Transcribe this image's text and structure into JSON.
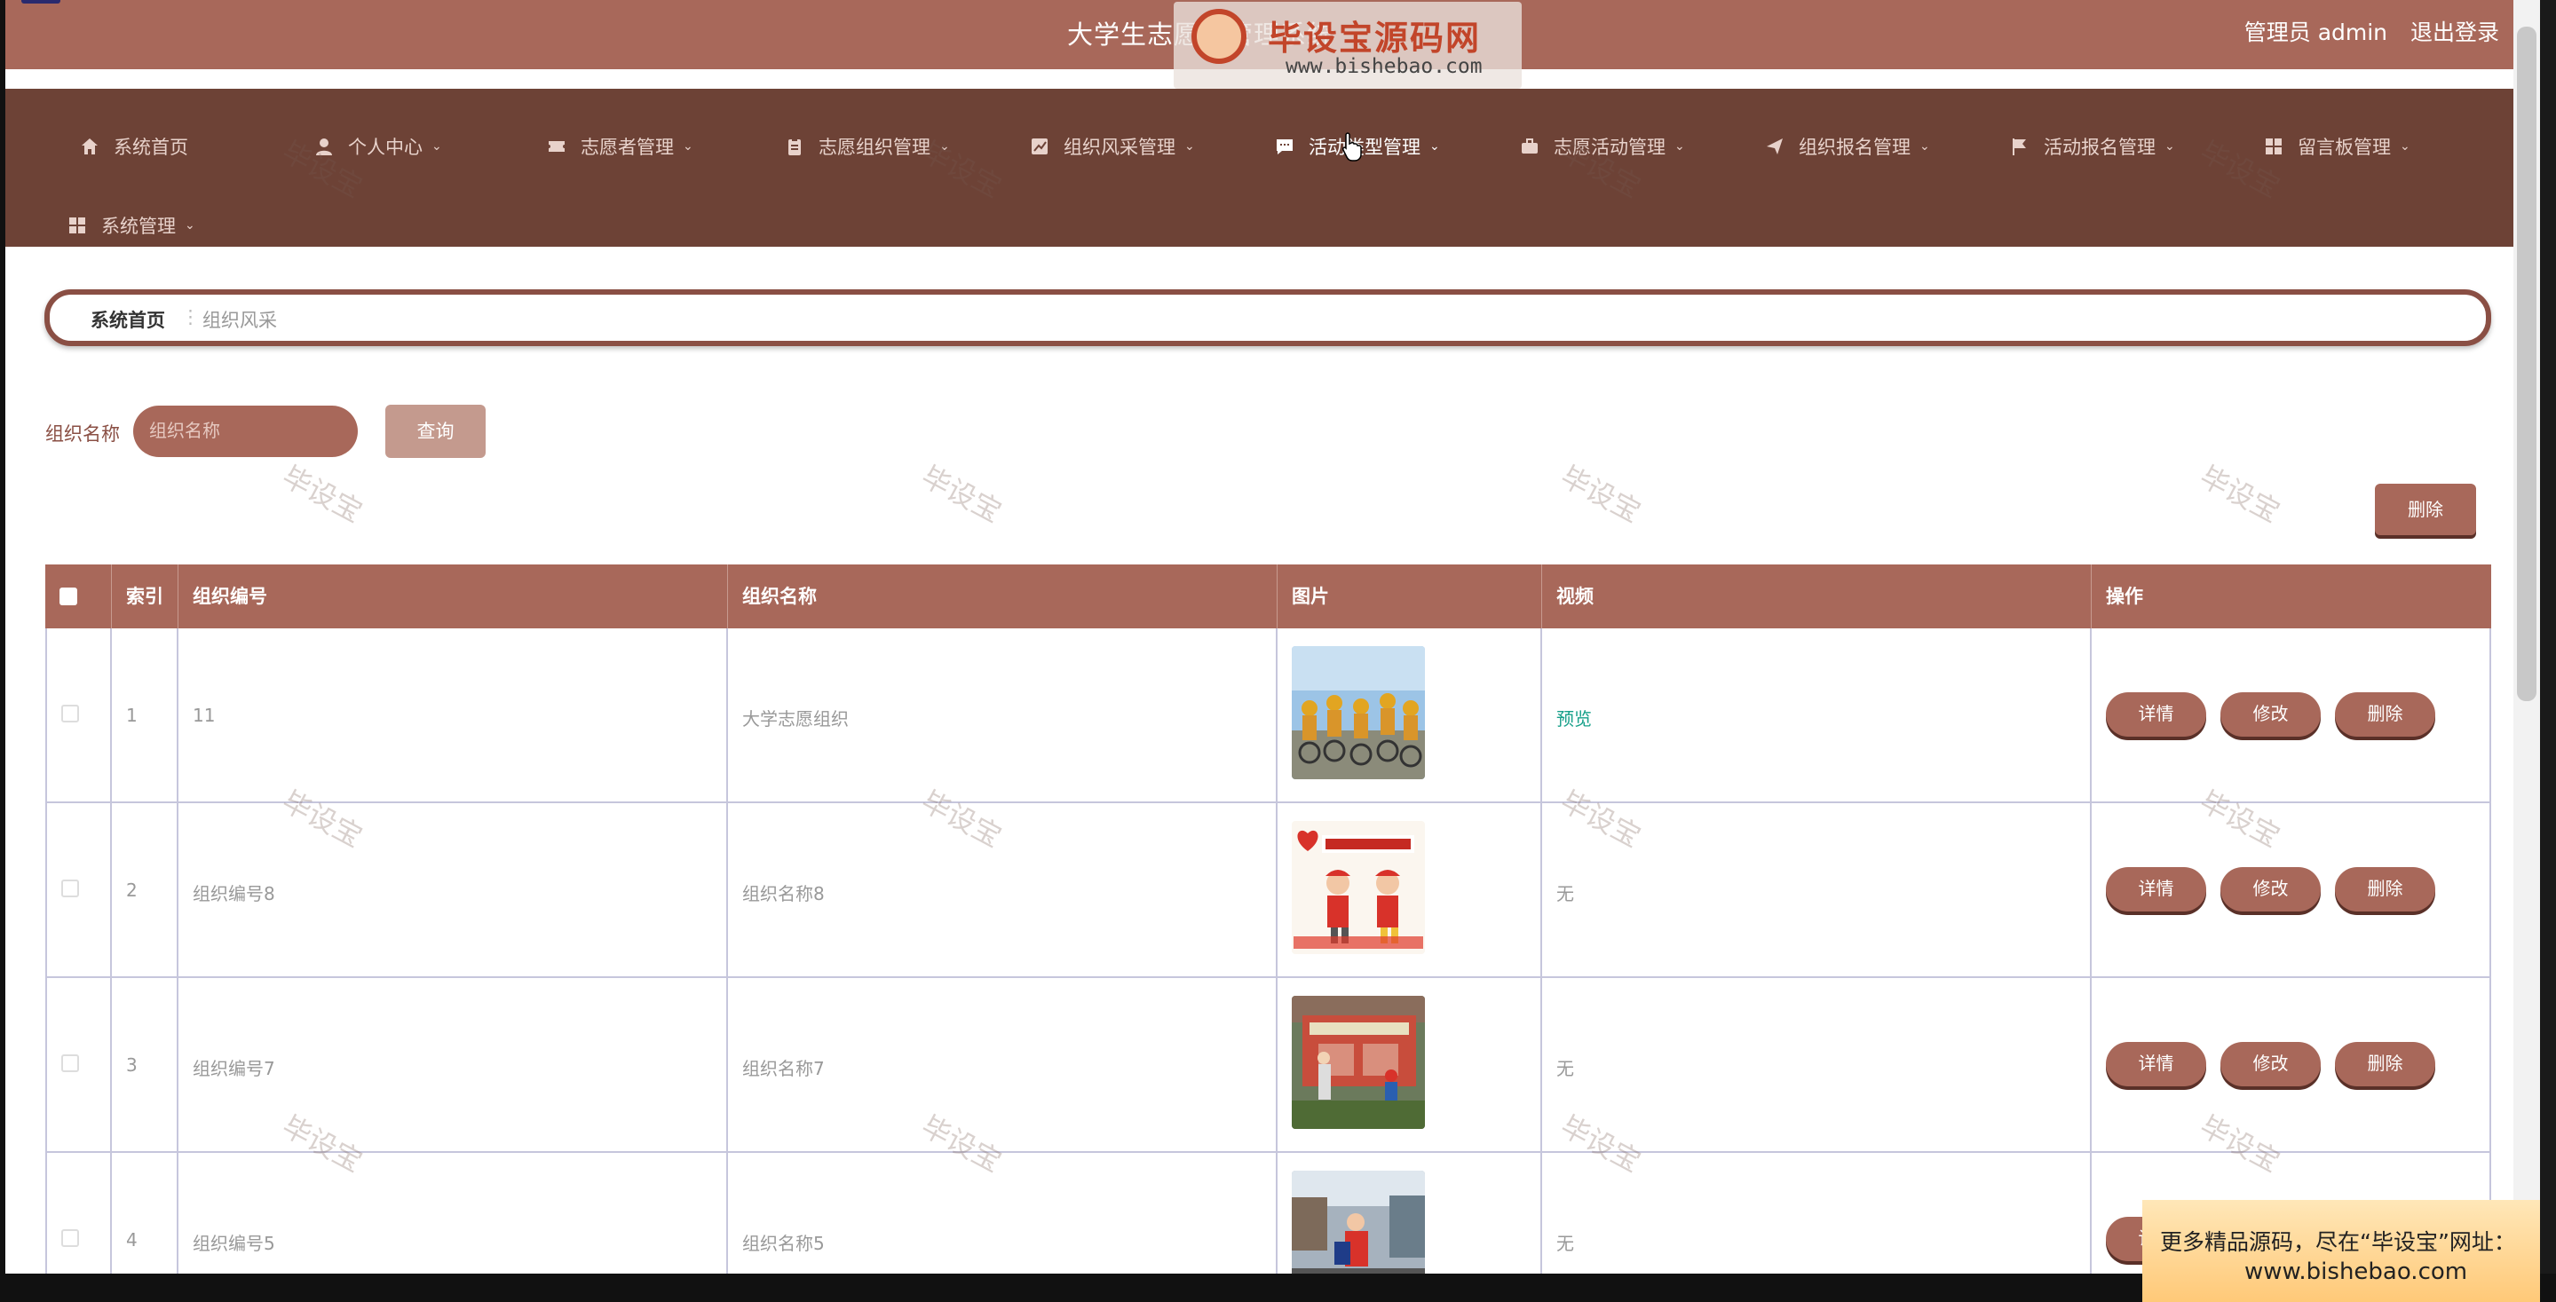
{
  "app": {
    "title": "大学生志愿者管理系统",
    "user_label": "管理员 admin",
    "logout_label": "退出登录"
  },
  "watermark_logo": {
    "text": "毕设宝源码网",
    "url": "www.bishebao.com"
  },
  "nav": {
    "items": [
      {
        "label": "系统首页",
        "icon": "home-icon",
        "has_caret": false
      },
      {
        "label": "个人中心",
        "icon": "person-icon",
        "has_caret": true
      },
      {
        "label": "志愿者管理",
        "icon": "ticket-icon",
        "has_caret": true
      },
      {
        "label": "志愿组织管理",
        "icon": "clipboard-icon",
        "has_caret": true
      },
      {
        "label": "组织风采管理",
        "icon": "chart-icon",
        "has_caret": true
      },
      {
        "label": "活动类型管理",
        "icon": "message-icon",
        "has_caret": true,
        "active": true
      },
      {
        "label": "志愿活动管理",
        "icon": "briefcase-icon",
        "has_caret": true
      },
      {
        "label": "组织报名管理",
        "icon": "send-icon",
        "has_caret": true
      },
      {
        "label": "活动报名管理",
        "icon": "flag-icon",
        "has_caret": true
      },
      {
        "label": "留言板管理",
        "icon": "grid-icon",
        "has_caret": true
      },
      {
        "label": "系统管理",
        "icon": "grid-icon",
        "has_caret": true
      }
    ]
  },
  "breadcrumb": {
    "home": "系统首页",
    "separator": "⋮",
    "current": "组织风采"
  },
  "search": {
    "label": "组织名称",
    "placeholder": "组织名称",
    "value": "",
    "button_label": "查询"
  },
  "toolbar": {
    "delete_label": "删除"
  },
  "table": {
    "columns": [
      "索引",
      "组织编号",
      "组织名称",
      "图片",
      "视频",
      "操作"
    ],
    "rows": [
      {
        "index": "1",
        "code": "11",
        "name": "大学志愿组织",
        "image": "cyclists-photo",
        "video": "预览"
      },
      {
        "index": "2",
        "code": "组织编号8",
        "name": "组织名称8",
        "image": "volunteer-day-poster",
        "video": "无"
      },
      {
        "index": "3",
        "code": "组织编号7",
        "name": "组织名称7",
        "image": "bulletin-board-photo",
        "video": "无"
      },
      {
        "index": "4",
        "code": "组织编号5",
        "name": "组织名称5",
        "image": "street-volunteer-photo",
        "video": "无"
      }
    ],
    "actions": {
      "detail": "详情",
      "edit": "修改",
      "delete": "删除"
    }
  },
  "watermark_text": "毕设宝",
  "promo": {
    "line1": "更多精品源码，尽在“毕设宝”网址：",
    "line2": "www.bishebao.com"
  },
  "colors": {
    "primary": "#a8685a",
    "nav_bg": "#6d4236",
    "preview_link": "#17a08a"
  }
}
